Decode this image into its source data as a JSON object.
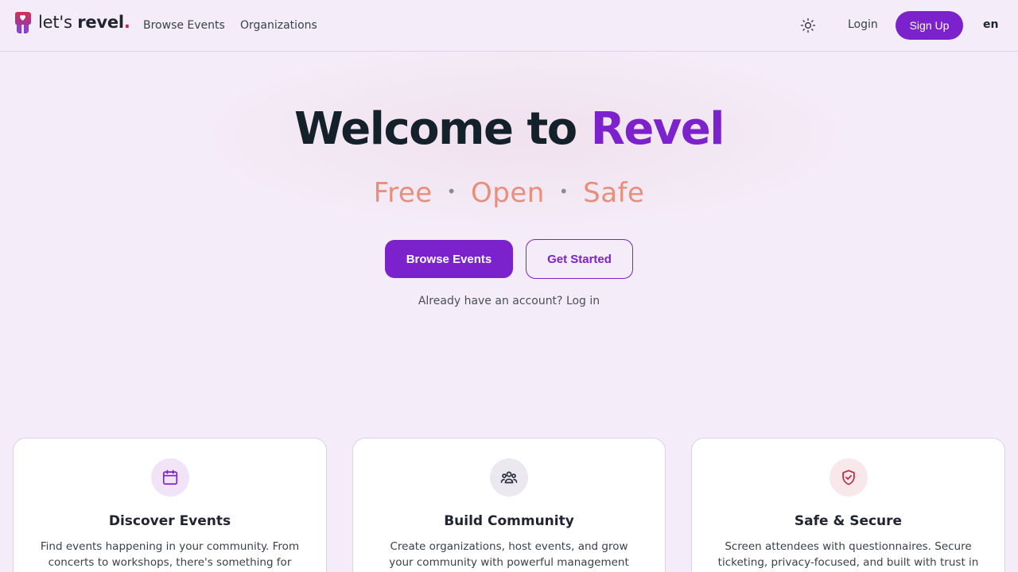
{
  "brand": {
    "prefix": "let's ",
    "name": "revel",
    "suffix": "."
  },
  "nav": {
    "browse_events": "Browse Events",
    "organizations": "Organizations"
  },
  "header": {
    "theme_icon": "sun-icon",
    "login": "Login",
    "signup": "Sign Up",
    "language": "en"
  },
  "hero": {
    "title_prefix": "Welcome to ",
    "title_accent": "Revel",
    "tagline": [
      "Free",
      "Open",
      "Safe"
    ],
    "tagline_separator": "•",
    "primary_button": "Browse Events",
    "secondary_button": "Get Started",
    "already_text": "Already have an account? ",
    "login_link": "Log in"
  },
  "features": [
    {
      "icon": "calendar-icon",
      "title": "Discover Events",
      "text": "Find events happening in your community. From concerts to workshops, there's something for",
      "icon_color": "#7b22cc",
      "icon_bg": "#f1e4f8"
    },
    {
      "icon": "users-icon",
      "title": "Build Community",
      "text": "Create organizations, host events, and grow your community with powerful management tools.",
      "icon_color": "#2a2f3b",
      "icon_bg": "#ebe8ef"
    },
    {
      "icon": "shield-check-icon",
      "title": "Safe & Secure",
      "text": "Screen attendees with questionnaires. Secure ticketing, privacy-focused, and built with trust in",
      "icon_color": "#c0293f",
      "icon_bg": "#f8e8ec"
    }
  ],
  "colors": {
    "accent": "#7b22cc",
    "tagline": "#e88e7b",
    "background": "#f4edf9"
  }
}
